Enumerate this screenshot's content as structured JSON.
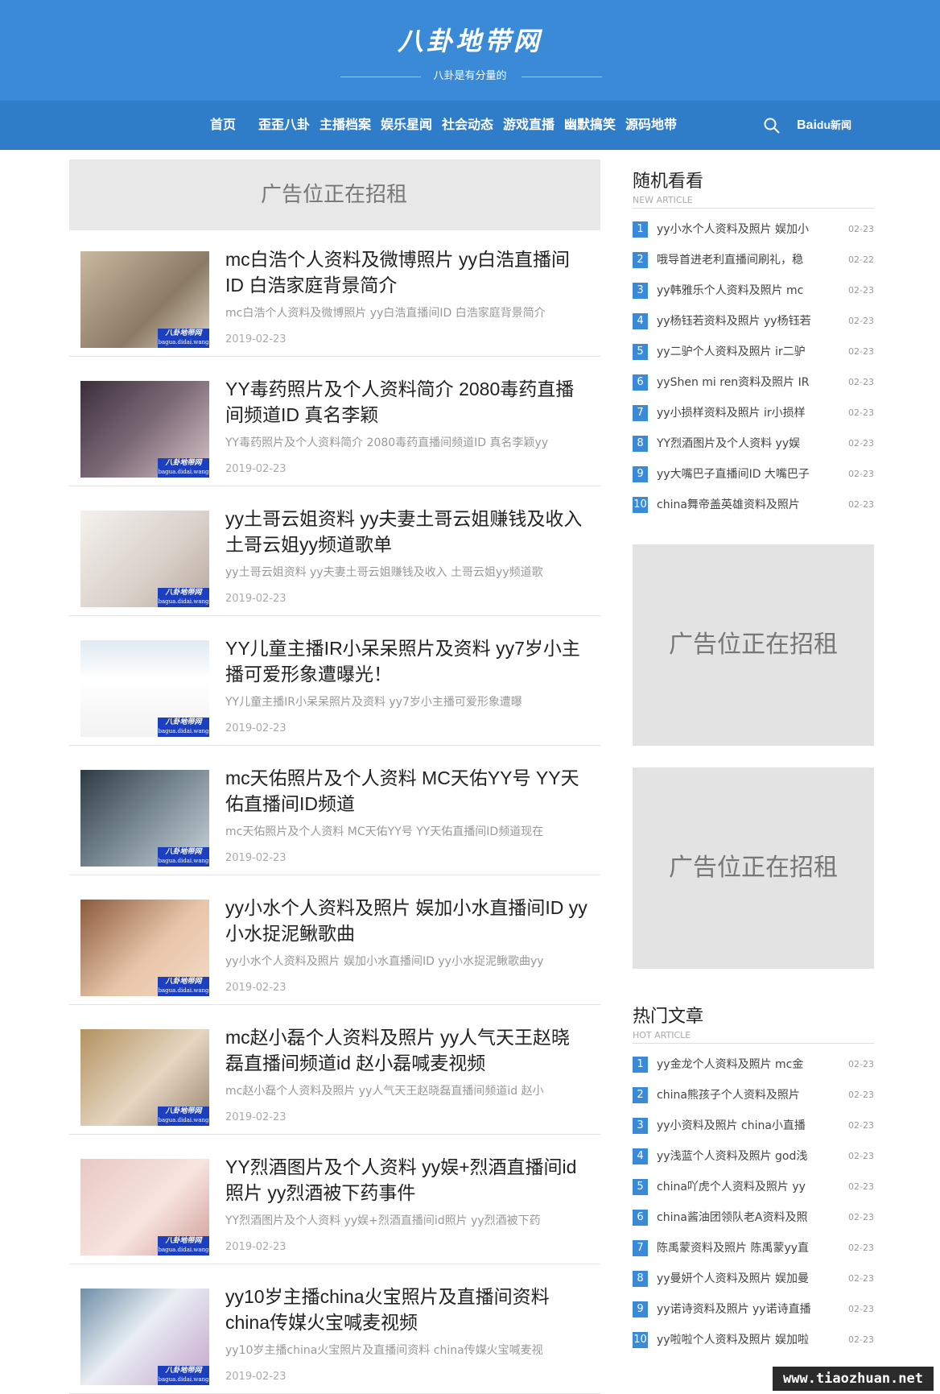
{
  "header": {
    "logo": "八卦地带网",
    "tagline": "八卦是有分量的"
  },
  "nav": {
    "items": [
      "首页",
      "歪歪八卦",
      "主播档案",
      "娱乐星闻",
      "社会动态",
      "游戏直播",
      "幽默搞笑",
      "源码地带"
    ],
    "search_icon": "search-icon",
    "baidu_logo": "Bai",
    "baidu_paw": "du",
    "baidu_news": "新闻"
  },
  "ad": {
    "text": "广告位正在招租"
  },
  "articles": [
    {
      "title": "mc白浩个人资料及微博照片 yy白浩直播间ID 白浩家庭背景简介",
      "excerpt": "mc白浩个人资料及微博照片 yy白浩直播间ID 白浩家庭背景简介",
      "date": "2019-02-23"
    },
    {
      "title": "YY毒药照片及个人资料简介 2080毒药直播间频道ID 真名李颖",
      "excerpt": "YY毒药照片及个人资料简介 2080毒药直播间频道ID 真名李颖yy",
      "date": "2019-02-23"
    },
    {
      "title": "yy土哥云姐资料 yy夫妻土哥云姐赚钱及收入 土哥云姐yy频道歌单",
      "excerpt": "yy土哥云姐资料 yy夫妻土哥云姐赚钱及收入 土哥云姐yy频道歌",
      "date": "2019-02-23"
    },
    {
      "title": "YY儿童主播IR小呆呆照片及资料 yy7岁小主播可爱形象遭曝光！",
      "excerpt": "YY儿童主播IR小呆呆照片及资料 yy7岁小主播可爱形象遭曝",
      "date": "2019-02-23"
    },
    {
      "title": "mc天佑照片及个人资料 MC天佑YY号 YY天佑直播间ID频道",
      "excerpt": "mc天佑照片及个人资料 MC天佑YY号 YY天佑直播间ID频道现在",
      "date": "2019-02-23"
    },
    {
      "title": "yy小水个人资料及照片 娱加小水直播间ID yy小水捉泥鳅歌曲",
      "excerpt": "yy小水个人资料及照片 娱加小水直播间ID yy小水捉泥鳅歌曲yy",
      "date": "2019-02-23"
    },
    {
      "title": "mc赵小磊个人资料及照片 yy人气天王赵晓磊直播间频道id 赵小磊喊麦视频",
      "excerpt": "mc赵小磊个人资料及照片 yy人气天王赵晓磊直播间频道id 赵小",
      "date": "2019-02-23"
    },
    {
      "title": "YY烈酒图片及个人资料 yy娱+烈酒直播间id照片 yy烈酒被下药事件",
      "excerpt": "YY烈酒图片及个人资料 yy娱+烈酒直播间id照片 yy烈酒被下药",
      "date": "2019-02-23"
    },
    {
      "title": "yy10岁主播china火宝照片及直播间资料 china传媒火宝喊麦视频",
      "excerpt": "yy10岁主播china火宝照片及直播间资料 china传媒火宝喊麦视",
      "date": "2019-02-23"
    }
  ],
  "thumb_watermark": {
    "text": "八卦地带网",
    "url": "bagua.didai.wang"
  },
  "sidebar": {
    "random": {
      "title": "随机看看",
      "subtitle": "NEW ARTICLE",
      "items": [
        {
          "num": "1",
          "title": "yy小水个人资料及照片 娱加小",
          "date": "02-23"
        },
        {
          "num": "2",
          "title": "哦导首进老利直播间刷礼，稳",
          "date": "02-22"
        },
        {
          "num": "3",
          "title": "yy韩雅乐个人资料及照片 mc",
          "date": "02-23"
        },
        {
          "num": "4",
          "title": "yy杨钰若资料及照片 yy杨钰若",
          "date": "02-23"
        },
        {
          "num": "5",
          "title": "yy二驴个人资料及照片 ir二驴",
          "date": "02-23"
        },
        {
          "num": "6",
          "title": "yyShen mi ren资料及照片 IR",
          "date": "02-23"
        },
        {
          "num": "7",
          "title": "yy小损样资料及照片 ir小损样",
          "date": "02-23"
        },
        {
          "num": "8",
          "title": "YY烈酒图片及个人资料 yy娱",
          "date": "02-23"
        },
        {
          "num": "9",
          "title": "yy大嘴巴子直播间ID 大嘴巴子",
          "date": "02-23"
        },
        {
          "num": "10",
          "title": "china舞帝盖英雄资料及照片",
          "date": "02-23"
        }
      ]
    },
    "hot": {
      "title": "热门文章",
      "subtitle": "HOT ARTICLE",
      "items": [
        {
          "num": "1",
          "title": "yy金龙个人资料及照片 mc金",
          "date": "02-23"
        },
        {
          "num": "2",
          "title": "china熊孩子个人资料及照片",
          "date": "02-23"
        },
        {
          "num": "3",
          "title": "yy小资料及照片 china小直播",
          "date": "02-23"
        },
        {
          "num": "4",
          "title": "yy浅蓝个人资料及照片 god浅",
          "date": "02-23"
        },
        {
          "num": "5",
          "title": "china吖虎个人资料及照片 yy",
          "date": "02-23"
        },
        {
          "num": "6",
          "title": "china酱油团领队老A资料及照",
          "date": "02-23"
        },
        {
          "num": "7",
          "title": "陈禹蒙资料及照片 陈禹蒙yy直",
          "date": "02-23"
        },
        {
          "num": "8",
          "title": "yy曼妍个人资料及照片 娱加曼",
          "date": "02-23"
        },
        {
          "num": "9",
          "title": "yy诺诗资料及照片 yy诺诗直播",
          "date": "02-23"
        },
        {
          "num": "10",
          "title": "yy啦啦个人资料及照片 娱加啦",
          "date": "02-23"
        }
      ]
    }
  },
  "site_watermark": "www.tiaozhuan.net",
  "colors": {
    "header_bg": "#3a8ad8",
    "nav_bg": "#2f7cc9",
    "rank_badge": "#3a8ad8",
    "ad_bg": "#e8e8e8"
  }
}
